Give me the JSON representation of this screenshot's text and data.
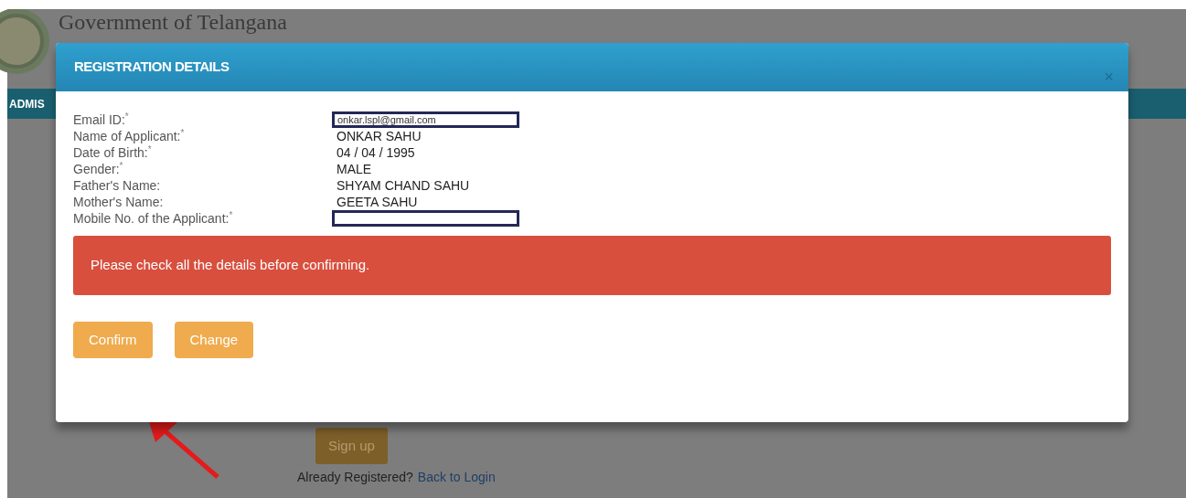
{
  "header": {
    "title": "Government of Telangana",
    "nav_label": "ADMIS"
  },
  "dialog": {
    "title": "REGISTRATION DETAILS",
    "close": "×",
    "fields": [
      {
        "kind": "redacted",
        "label": "Email ID:",
        "mark": "*",
        "value": "onkar.lspl@gmail.com"
      },
      {
        "kind": "text",
        "label": "Name of Applicant:",
        "mark": "*",
        "value": "ONKAR SAHU"
      },
      {
        "kind": "text",
        "label": "Date of Birth:",
        "mark": "*",
        "value": "04 / 04 / 1995"
      },
      {
        "kind": "text",
        "label": "Gender:",
        "mark": "*",
        "value": "MALE"
      },
      {
        "kind": "text",
        "label": "Father's Name:",
        "value": "SHYAM CHAND SAHU"
      },
      {
        "kind": "text",
        "label": "Mother's Name:",
        "value": "GEETA SAHU"
      },
      {
        "kind": "redacted",
        "label": "Mobile No. of the Applicant:",
        "mark": "*"
      }
    ],
    "alert": "Please check all the details before confirming.",
    "buttons": [
      "Confirm",
      "Change"
    ]
  },
  "page": {
    "signup_button": "Sign up",
    "login_prompt": "Already Registered?",
    "login_link": "Back to Login"
  }
}
